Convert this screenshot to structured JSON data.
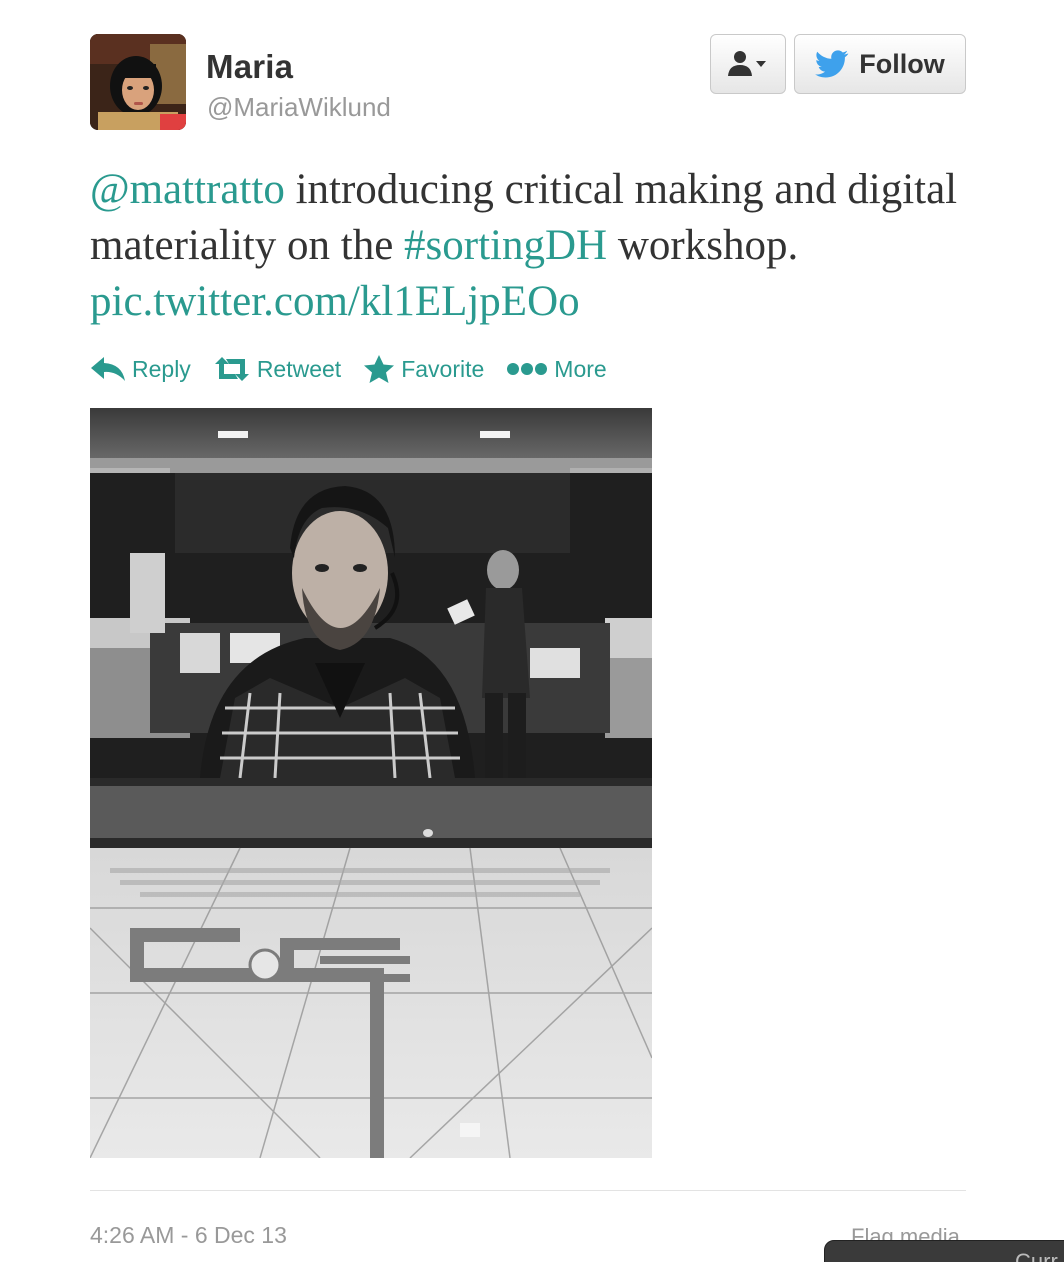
{
  "user": {
    "name": "Maria",
    "handle": "@MariaWiklund"
  },
  "buttons": {
    "follow_label": "Follow"
  },
  "tweet": {
    "mention": "@mattratto",
    "text_1": " introducing critical making and digital materiality on the ",
    "hashtag": "#sortingDH",
    "text_2": " workshop. ",
    "link": "pic.twitter.com/kl1ELjpEOo"
  },
  "actions": {
    "reply": "Reply",
    "retweet": "Retweet",
    "favorite": "Favorite",
    "more": "More"
  },
  "footer": {
    "timestamp": "4:26 AM - 6 Dec 13",
    "flag": "Flag media",
    "corner_tab": "Curr"
  },
  "colors": {
    "link": "#2a9a8f",
    "twitter_bird": "#3ea1ec"
  },
  "icons": [
    "user-dropdown-icon",
    "twitter-bird-icon",
    "reply-icon",
    "retweet-icon",
    "favorite-icon",
    "more-icon"
  ]
}
